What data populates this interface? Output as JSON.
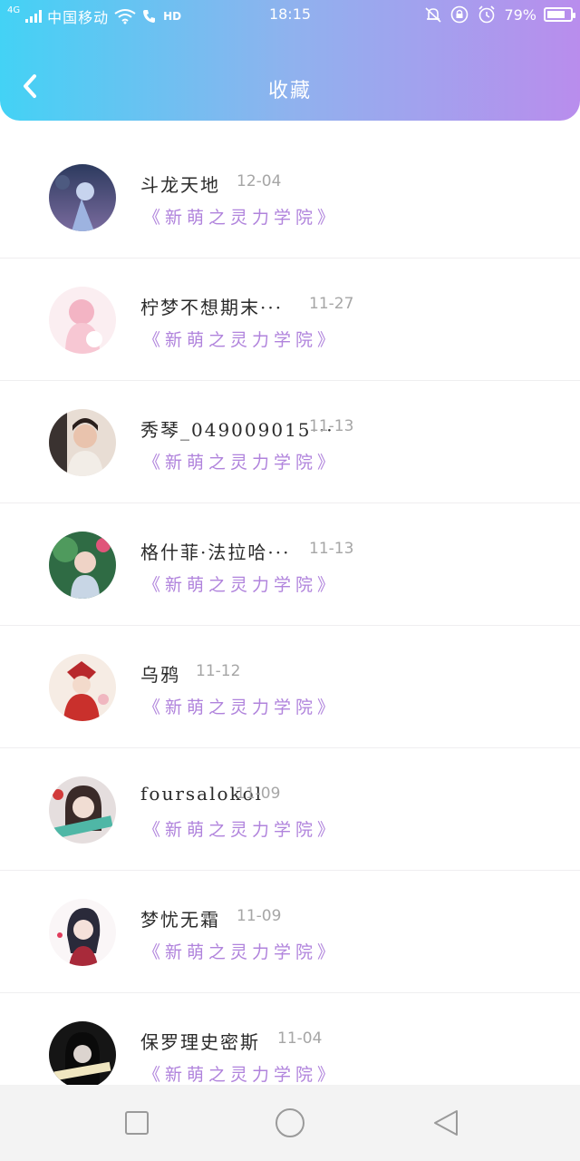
{
  "status_bar": {
    "network": "4G",
    "carrier": "中国移动",
    "call_badge": "HD",
    "time": "18:15",
    "battery": "79%",
    "battery_level": 0.79
  },
  "header": {
    "title": "收藏",
    "back_icon": "chevron-left-icon"
  },
  "favorites": [
    {
      "name": "斗龙天地",
      "date": "12-04",
      "book": "《新萌之灵力学院》"
    },
    {
      "name": "柠梦不想期末···",
      "date": "11-27",
      "book": "《新萌之灵力学院》"
    },
    {
      "name": "秀琴_049009015···",
      "date": "11-13",
      "book": "《新萌之灵力学院》"
    },
    {
      "name": "格什菲·法拉哈···",
      "date": "11-13",
      "book": "《新萌之灵力学院》"
    },
    {
      "name": "乌鸦",
      "date": "11-12",
      "book": "《新萌之灵力学院》"
    },
    {
      "name": "foursalokol",
      "date": "11-09",
      "book": "《新萌之灵力学院》"
    },
    {
      "name": "梦忧无霜",
      "date": "11-09",
      "book": "《新萌之灵力学院》"
    },
    {
      "name": "保罗理史密斯",
      "date": "11-04",
      "book": "《新萌之灵力学院》"
    }
  ],
  "nav_bar": {
    "icons": [
      "square-icon",
      "circle-icon",
      "triangle-back-icon"
    ]
  },
  "colors": {
    "header_gradient_start": "#43d2f5",
    "header_gradient_end": "#b98ded",
    "book_title": "#b083dc"
  }
}
